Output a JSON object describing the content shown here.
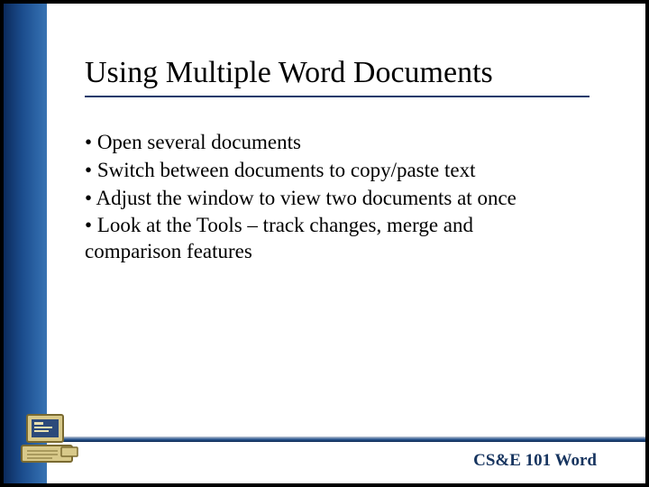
{
  "slide": {
    "title": "Using Multiple Word Documents",
    "bullets": [
      "Open several documents",
      "Switch between documents to copy/paste text",
      "Adjust the window to view two documents at once",
      "Look at the Tools – track changes, merge and comparison features"
    ],
    "footer": "CS&E 101  Word"
  },
  "colors": {
    "sidebar_gradient_dark": "#0b2a5b",
    "sidebar_gradient_light": "#3a74b2",
    "rule": "#163a6b",
    "footer_text": "#16345f"
  },
  "icons": {
    "computer": "computer-icon"
  }
}
